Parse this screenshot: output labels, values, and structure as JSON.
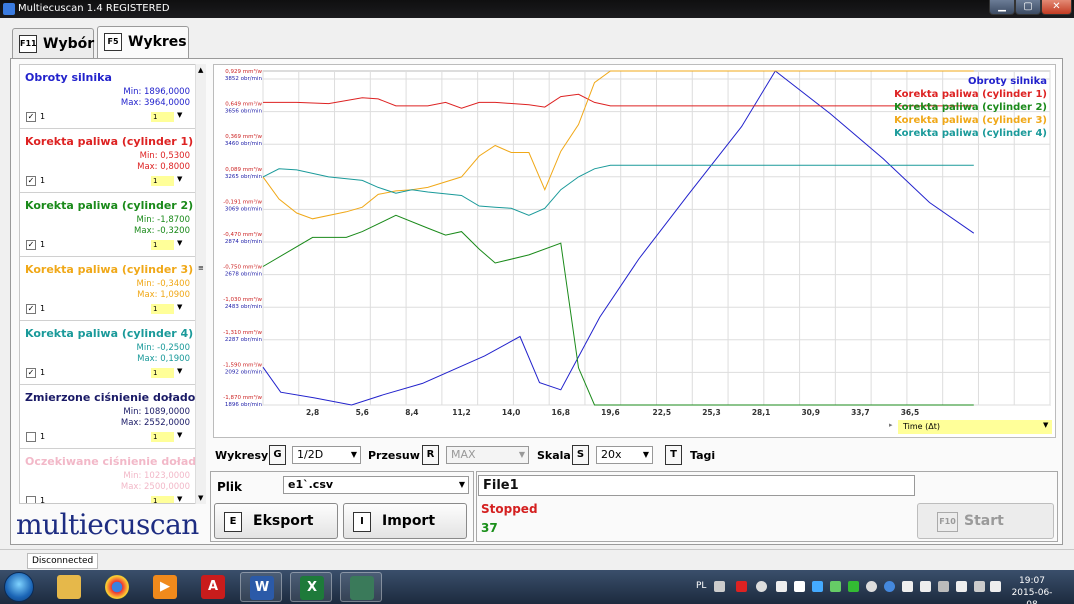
{
  "window": {
    "title": "Multiecuscan 1.4 REGISTERED",
    "min": "▁",
    "max": "▢",
    "close": "✕"
  },
  "tabs": [
    {
      "key": "F11",
      "label": "Wybór"
    },
    {
      "key": "F5",
      "label": "Wykres"
    }
  ],
  "sensors": [
    {
      "name": "Obroty silnika",
      "min": "Min: 1896,0000",
      "max": "Max: 3964,0000",
      "checked": "✓",
      "num": "1",
      "sel": "1",
      "color": "#2222cc"
    },
    {
      "name": "Korekta paliwa (cylinder 1)",
      "min": "Min: 0,5300",
      "max": "Max: 0,8000",
      "checked": "✓",
      "num": "1",
      "sel": "1",
      "color": "#dd2222"
    },
    {
      "name": "Korekta paliwa (cylinder 2)",
      "min": "Min: -1,8700",
      "max": "Max: -0,3200",
      "checked": "✓",
      "num": "1",
      "sel": "1",
      "color": "#1a8a1a"
    },
    {
      "name": "Korekta paliwa (cylinder 3)",
      "min": "Min: -0,3400",
      "max": "Max: 1,0900",
      "checked": "✓",
      "num": "1",
      "sel": "1",
      "color": "#f0a818"
    },
    {
      "name": "Korekta paliwa (cylinder 4)",
      "min": "Min: -0,2500",
      "max": "Max: 0,1900",
      "checked": "✓",
      "num": "1",
      "sel": "1",
      "color": "#1a9a9a"
    },
    {
      "name": "Zmierzone ciśnienie doładowania",
      "min": "Min: 1089,0000",
      "max": "Max: 2552,0000",
      "checked": "",
      "num": "1",
      "sel": "1",
      "color": "#1a1a66"
    },
    {
      "name": "Oczekiwane ciśnienie doładowania",
      "min": "Min: 1023,0000",
      "max": "Max: 2500,0000",
      "checked": "",
      "num": "1",
      "sel": "1",
      "color": "#f2b8c8"
    }
  ],
  "logo": "multiecuscan",
  "chart_data": {
    "type": "line",
    "x": [
      0.0,
      0.9,
      1.9,
      2.8,
      3.7,
      4.7,
      5.6,
      6.5,
      7.5,
      8.4,
      9.3,
      10.3,
      11.2,
      12.2,
      13.1,
      14.0,
      15.0,
      15.9,
      16.8,
      17.8,
      18.7,
      19.6,
      36.5
    ],
    "x_ticks": [
      "2,8",
      "5,6",
      "8,4",
      "11,2",
      "14,0",
      "16,8",
      "19,6",
      "22,5",
      "25,3",
      "28,1",
      "30,9",
      "33,7",
      "36,5"
    ],
    "y_ticks": [
      {
        "a": "0,929 mm³/w",
        "b": "3852 obr/min"
      },
      {
        "a": "0,649 mm³/w",
        "b": "3656 obr/min"
      },
      {
        "a": "0,369 mm³/w",
        "b": "3460 obr/min"
      },
      {
        "a": "0,089 mm³/w",
        "b": "3265 obr/min"
      },
      {
        "a": "-0,191 mm³/w",
        "b": "3069 obr/min"
      },
      {
        "a": "-0,470 mm³/w",
        "b": "2874 obr/min"
      },
      {
        "a": "-0,750 mm³/w",
        "b": "2678 obr/min"
      },
      {
        "a": "-1,030 mm³/w",
        "b": "2483 obr/min"
      },
      {
        "a": "-1,310 mm³/w",
        "b": "2287 obr/min"
      },
      {
        "a": "-1,590 mm³/w",
        "b": "2092 obr/min"
      },
      {
        "a": "-1,870 mm³/w",
        "b": "1896 obr/min"
      }
    ],
    "ylim_fuel": [
      -1.87,
      1.0
    ],
    "ylim_rpm": [
      1896,
      3964
    ],
    "grid": true,
    "legend": "top-right",
    "series": [
      {
        "name": "Obroty silnika",
        "color": "#2222cc",
        "axis": "rpm",
        "points": [
          [
            0.0,
            2130
          ],
          [
            1.0,
            1975
          ],
          [
            2.9,
            1940
          ],
          [
            5.0,
            1896
          ],
          [
            6.8,
            1960
          ],
          [
            9.0,
            2030
          ],
          [
            12.5,
            2200
          ],
          [
            14.5,
            2320
          ],
          [
            15.6,
            2035
          ],
          [
            16.8,
            1990
          ],
          [
            19.0,
            2440
          ],
          [
            21.2,
            2800
          ],
          [
            24.0,
            3200
          ],
          [
            27.0,
            3620
          ],
          [
            28.9,
            3964
          ],
          [
            32.0,
            3700
          ],
          [
            35.0,
            3420
          ],
          [
            37.6,
            3150
          ],
          [
            40.1,
            2960
          ]
        ]
      },
      {
        "name": "Korekta paliwa (cylinder 1)",
        "color": "#dd2222",
        "axis": "fuel",
        "points": [
          [
            0.0,
            0.73
          ],
          [
            1.9,
            0.73
          ],
          [
            3.7,
            0.72
          ],
          [
            5.6,
            0.77
          ],
          [
            6.5,
            0.76
          ],
          [
            7.5,
            0.7
          ],
          [
            9.3,
            0.7
          ],
          [
            10.3,
            0.73
          ],
          [
            11.2,
            0.68
          ],
          [
            12.2,
            0.73
          ],
          [
            13.1,
            0.73
          ],
          [
            15.0,
            0.71
          ],
          [
            15.9,
            0.69
          ],
          [
            16.8,
            0.78
          ],
          [
            17.8,
            0.8
          ],
          [
            18.7,
            0.73
          ],
          [
            19.6,
            0.7
          ],
          [
            40.1,
            0.7
          ]
        ]
      },
      {
        "name": "Korekta paliwa (cylinder 2)",
        "color": "#1a8a1a",
        "axis": "fuel",
        "points": [
          [
            0.0,
            -0.68
          ],
          [
            2.8,
            -0.43
          ],
          [
            4.7,
            -0.43
          ],
          [
            5.6,
            -0.38
          ],
          [
            7.5,
            -0.24
          ],
          [
            9.3,
            -0.35
          ],
          [
            10.3,
            -0.41
          ],
          [
            11.2,
            -0.38
          ],
          [
            12.2,
            -0.53
          ],
          [
            13.1,
            -0.65
          ],
          [
            15.0,
            -0.58
          ],
          [
            16.8,
            -0.48
          ],
          [
            17.8,
            -1.55
          ],
          [
            18.7,
            -1.87
          ],
          [
            40.1,
            -1.87
          ]
        ]
      },
      {
        "name": "Korekta paliwa (cylinder 3)",
        "color": "#f0a818",
        "axis": "fuel",
        "points": [
          [
            0.0,
            0.09
          ],
          [
            0.9,
            -0.1
          ],
          [
            1.9,
            -0.22
          ],
          [
            2.8,
            -0.27
          ],
          [
            4.7,
            -0.21
          ],
          [
            5.6,
            -0.17
          ],
          [
            6.5,
            -0.06
          ],
          [
            7.5,
            -0.03
          ],
          [
            8.4,
            -0.02
          ],
          [
            9.3,
            0.0
          ],
          [
            11.2,
            0.09
          ],
          [
            12.2,
            0.27
          ],
          [
            13.1,
            0.36
          ],
          [
            14.0,
            0.3
          ],
          [
            15.0,
            0.3
          ],
          [
            15.9,
            -0.02
          ],
          [
            16.8,
            0.31
          ],
          [
            17.8,
            0.54
          ],
          [
            18.7,
            0.9
          ],
          [
            19.6,
            1.0
          ],
          [
            40.1,
            1.0
          ]
        ]
      },
      {
        "name": "Korekta paliwa (cylinder 4)",
        "color": "#1a9a9a",
        "axis": "fuel",
        "points": [
          [
            0.0,
            0.09
          ],
          [
            0.9,
            0.16
          ],
          [
            1.9,
            0.15
          ],
          [
            3.7,
            0.09
          ],
          [
            5.6,
            0.06
          ],
          [
            6.5,
            0.0
          ],
          [
            7.5,
            -0.05
          ],
          [
            8.4,
            -0.02
          ],
          [
            9.3,
            -0.04
          ],
          [
            11.2,
            -0.07
          ],
          [
            12.2,
            -0.16
          ],
          [
            13.1,
            -0.17
          ],
          [
            14.0,
            -0.18
          ],
          [
            15.0,
            -0.24
          ],
          [
            15.9,
            -0.18
          ],
          [
            16.8,
            -0.02
          ],
          [
            17.8,
            0.09
          ],
          [
            18.7,
            0.16
          ],
          [
            19.6,
            0.19
          ],
          [
            40.1,
            0.19
          ]
        ]
      }
    ]
  },
  "time_selector": {
    "value": "Time (Δt)"
  },
  "controls": {
    "wykresy_label": "Wykresy",
    "wykresy_key": "G",
    "wykresy_value": "1/2D",
    "przesuw_label": "Przesuw",
    "przesuw_key": "R",
    "przesuw_value": "MAX",
    "skala_label": "Skala",
    "skala_key": "S",
    "skala_value": "20x",
    "tagi_key": "T",
    "tagi_label": "Tagi"
  },
  "file_panel": {
    "plik_label": "Plik",
    "file_value": "e1`.csv",
    "eksport_key": "E",
    "eksport_label": "Eksport",
    "import_key": "I",
    "import_label": "Import"
  },
  "record_panel": {
    "file_name": "File1",
    "status": "Stopped",
    "count": "37",
    "start_key": "F10",
    "start_label": "Start"
  },
  "statusbar": {
    "connection": "Disconnected"
  },
  "taskbar": {
    "lang": "PL",
    "time": "19:07",
    "date": "2015-06-08"
  }
}
